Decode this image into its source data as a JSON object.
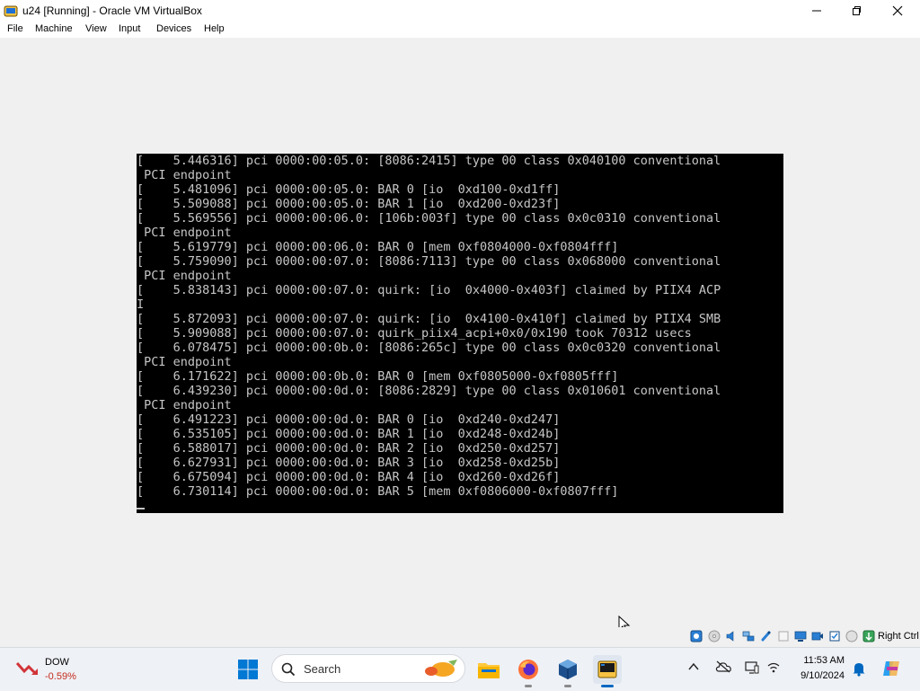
{
  "window": {
    "title": "u24 [Running] - Oracle VM VirtualBox",
    "app_icon": "virtualbox-icon",
    "controls": [
      "minimize-icon",
      "maximize-icon",
      "close-icon"
    ]
  },
  "menu": {
    "items": [
      "File",
      "Machine",
      "View",
      "Input",
      "Devices",
      "Help"
    ]
  },
  "console": {
    "lines": [
      "[    5.446316] pci 0000:00:05.0: [8086:2415] type 00 class 0x040100 conventional",
      " PCI endpoint",
      "[    5.481096] pci 0000:00:05.0: BAR 0 [io  0xd100-0xd1ff]",
      "[    5.509088] pci 0000:00:05.0: BAR 1 [io  0xd200-0xd23f]",
      "[    5.569556] pci 0000:00:06.0: [106b:003f] type 00 class 0x0c0310 conventional",
      " PCI endpoint",
      "[    5.619779] pci 0000:00:06.0: BAR 0 [mem 0xf0804000-0xf0804fff]",
      "[    5.759090] pci 0000:00:07.0: [8086:7113] type 00 class 0x068000 conventional",
      " PCI endpoint",
      "[    5.838143] pci 0000:00:07.0: quirk: [io  0x4000-0x403f] claimed by PIIX4 ACP",
      "I",
      "[    5.872093] pci 0000:00:07.0: quirk: [io  0x4100-0x410f] claimed by PIIX4 SMB",
      "[    5.909088] pci 0000:00:07.0: quirk_piix4_acpi+0x0/0x190 took 70312 usecs",
      "[    6.078475] pci 0000:00:0b.0: [8086:265c] type 00 class 0x0c0320 conventional",
      " PCI endpoint",
      "[    6.171622] pci 0000:00:0b.0: BAR 0 [mem 0xf0805000-0xf0805fff]",
      "[    6.439230] pci 0000:00:0d.0: [8086:2829] type 00 class 0x010601 conventional",
      " PCI endpoint",
      "[    6.491223] pci 0000:00:0d.0: BAR 0 [io  0xd240-0xd247]",
      "[    6.535105] pci 0000:00:0d.0: BAR 1 [io  0xd248-0xd24b]",
      "[    6.588017] pci 0000:00:0d.0: BAR 2 [io  0xd250-0xd257]",
      "[    6.627931] pci 0000:00:0d.0: BAR 3 [io  0xd258-0xd25b]",
      "[    6.675094] pci 0000:00:0d.0: BAR 4 [io  0xd260-0xd26f]",
      "[    6.730114] pci 0000:00:0d.0: BAR 5 [mem 0xf0806000-0xf0807fff]"
    ]
  },
  "statusbar": {
    "icons": [
      "hard-disk-icon",
      "optical-drive-icon",
      "audio-icon",
      "network-icon",
      "usb-icon",
      "shared-folders-icon",
      "display-icon",
      "recording-icon",
      "cpu-icon",
      "mouse-integration-icon",
      "keyboard-capture-icon"
    ],
    "host_key": "Right Ctrl"
  },
  "taskbar": {
    "stock": {
      "name": "DOW",
      "change": "-0.59%"
    },
    "search_placeholder": "Search",
    "apps": [
      "start-icon",
      "file-explorer-icon",
      "firefox-icon",
      "virtualbox-icon",
      "virtualbox-vm-icon"
    ],
    "tray_icons": [
      "chevron-up-icon",
      "onedrive-icon",
      "display-settings-icon",
      "network-status-icon",
      "notification-bell-icon",
      "copilot-icon"
    ],
    "clock": {
      "time": "11:53 AM",
      "date": "9/10/2024"
    }
  },
  "colors": {
    "console_background": "#000000",
    "console_text": "#c6c6c6",
    "accent": "#0067c0",
    "stock_negative": "#c42b1c"
  }
}
